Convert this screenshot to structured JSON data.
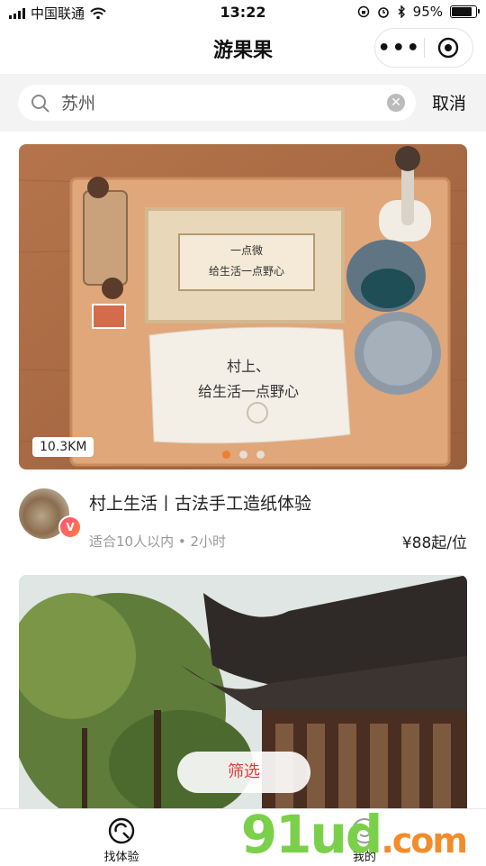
{
  "status_bar": {
    "carrier": "中国联通",
    "time": "13:22",
    "battery": "95%",
    "battery_level": 0.95
  },
  "nav": {
    "title": "游果果",
    "more_glyph": "•••"
  },
  "search": {
    "value": "苏州",
    "clear_glyph": "✕",
    "cancel_label": "取消"
  },
  "cards": [
    {
      "distance": "10.3KM",
      "title": "村上生活丨古法手工造纸体验",
      "meta": "适合10人以内 • 2小时",
      "price": "¥88起/位",
      "avatar_badge": "V",
      "image_text_1": "村上、",
      "image_text_2": "给生活一点野心"
    }
  ],
  "filter": {
    "label": "筛选"
  },
  "tabbar": {
    "items": [
      {
        "label": "找体验",
        "icon": "explore-icon"
      },
      {
        "label": "我的",
        "icon": "user-icon"
      }
    ]
  },
  "watermark": {
    "text_main": "91ud",
    "text_com": ".com"
  }
}
